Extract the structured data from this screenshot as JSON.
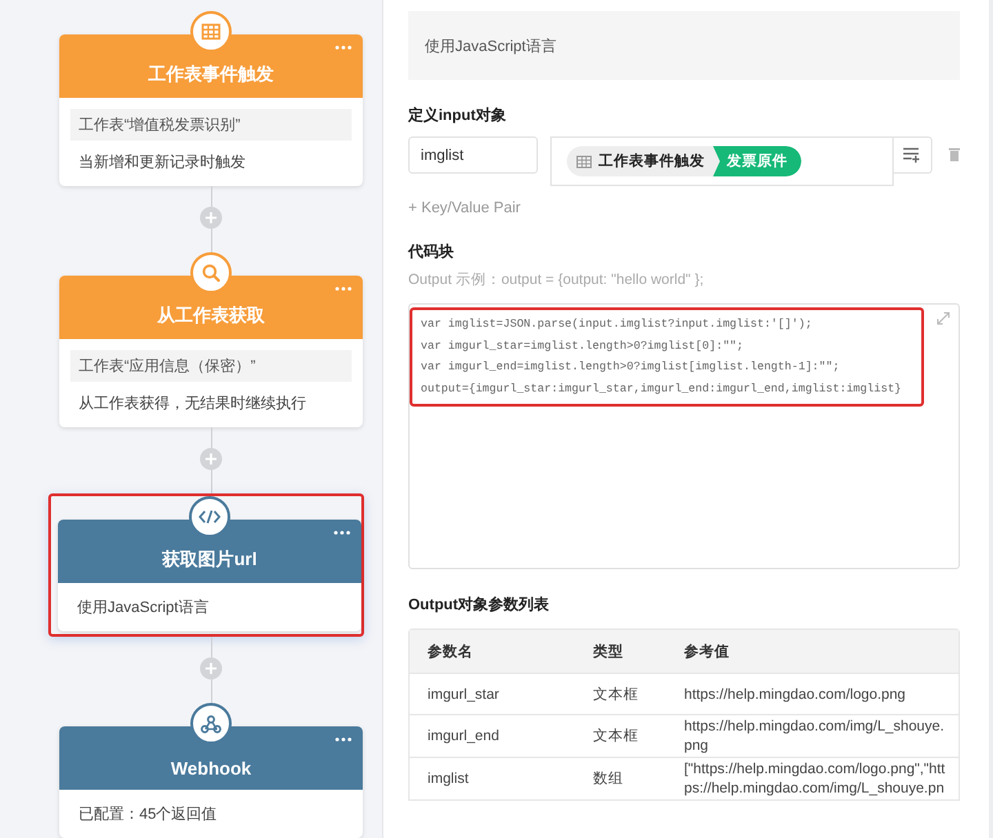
{
  "flow": {
    "nodes": [
      {
        "kind": "trigger",
        "color": "#f79d3a",
        "title": "工作表事件触发",
        "target": "工作表“增值税发票识别”",
        "description": "当新增和更新记录时触发",
        "highlighted": false
      },
      {
        "kind": "query",
        "color": "#f79d3a",
        "title": "从工作表获取",
        "target": "工作表“应用信息（保密）”",
        "description": "从工作表获得，无结果时继续执行",
        "highlighted": false
      },
      {
        "kind": "code",
        "color": "#4a7a9c",
        "title": "获取图片url",
        "description": "使用JavaScript语言",
        "highlighted": true
      },
      {
        "kind": "webhook",
        "color": "#4a7a9c",
        "title": "Webhook",
        "description": "已配置：45个返回值",
        "highlighted": false
      }
    ]
  },
  "panel": {
    "description": "使用JavaScript语言",
    "input_section": {
      "title": "定义input对象",
      "pairs": [
        {
          "key": "imglist",
          "source": "工作表事件触发",
          "field": "发票原件"
        }
      ],
      "add_link": "+ Key/Value Pair"
    },
    "code_section": {
      "title": "代码块",
      "hint": "Output 示例：output = {output: \"hello world\" };",
      "highlighted": true,
      "lines": [
        "var imglist=JSON.parse(input.imglist?input.imglist:'[]');",
        "var imgurl_star=imglist.length>0?imglist[0]:\"\";",
        "var imgurl_end=imglist.length>0?imglist[imglist.length-1]:\"\";",
        "output={imgurl_star:imgurl_star,imgurl_end:imgurl_end,imglist:imglist}"
      ]
    },
    "output_section": {
      "title": "Output对象参数列表",
      "columns": [
        "参数名",
        "类型",
        "参考值"
      ],
      "rows": [
        [
          "imgurl_star",
          "文本框",
          "https://help.mingdao.com/logo.png"
        ],
        [
          "imgurl_end",
          "文本框",
          "https://help.mingdao.com/img/L_shouye.png"
        ],
        [
          "imglist",
          "数组",
          "[\"https://help.mingdao.com/logo.png\",\"https://help.mingdao.com/img/L_shouye.pn"
        ]
      ]
    }
  }
}
